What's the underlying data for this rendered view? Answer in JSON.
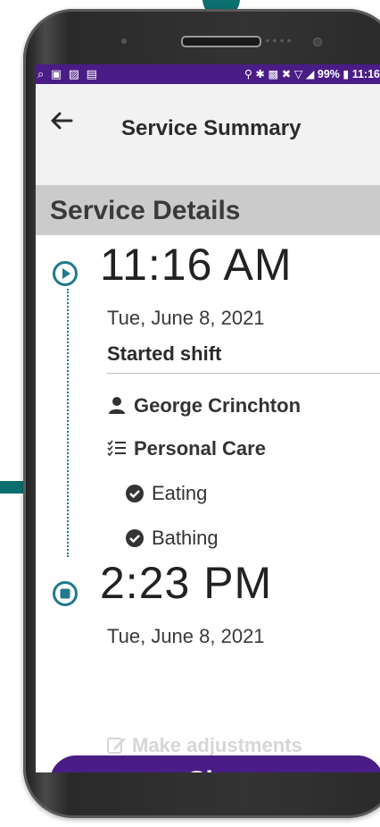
{
  "status_bar": {
    "left_icons": "⌕ ▣ ▨ ▤",
    "right_text": "⚲ ✱ ▩ ✖ ▽ ◢ 99% ▮ 11:16",
    "battery": "99%",
    "clock": "11:16"
  },
  "app_bar": {
    "back_icon": "arrow-left-icon",
    "title": "Service Summary"
  },
  "section": {
    "title": "Service Details"
  },
  "timeline": {
    "start": {
      "time": "11:16 AM",
      "date": "Tue, June 8, 2021",
      "event": "Started shift",
      "marker_icon": "play-circle-icon"
    },
    "client": {
      "icon": "person-icon",
      "name": "George Crinchton"
    },
    "care_type": {
      "icon": "checklist-icon",
      "label": "Personal Care",
      "tasks": [
        {
          "icon": "check-circle-icon",
          "label": "Eating"
        },
        {
          "icon": "check-circle-icon",
          "label": "Bathing"
        }
      ]
    },
    "end": {
      "time": "2:23 PM",
      "date": "Tue, June 8, 2021",
      "marker_icon": "stop-circle-icon"
    },
    "adjust": {
      "icon": "edit-icon",
      "label": "Make adjustments"
    }
  },
  "actions": {
    "sign_label": "Sign"
  },
  "colors": {
    "primary": "#4a1d86",
    "accent": "#0c6f6f",
    "timeline": "#1f7a8a"
  }
}
